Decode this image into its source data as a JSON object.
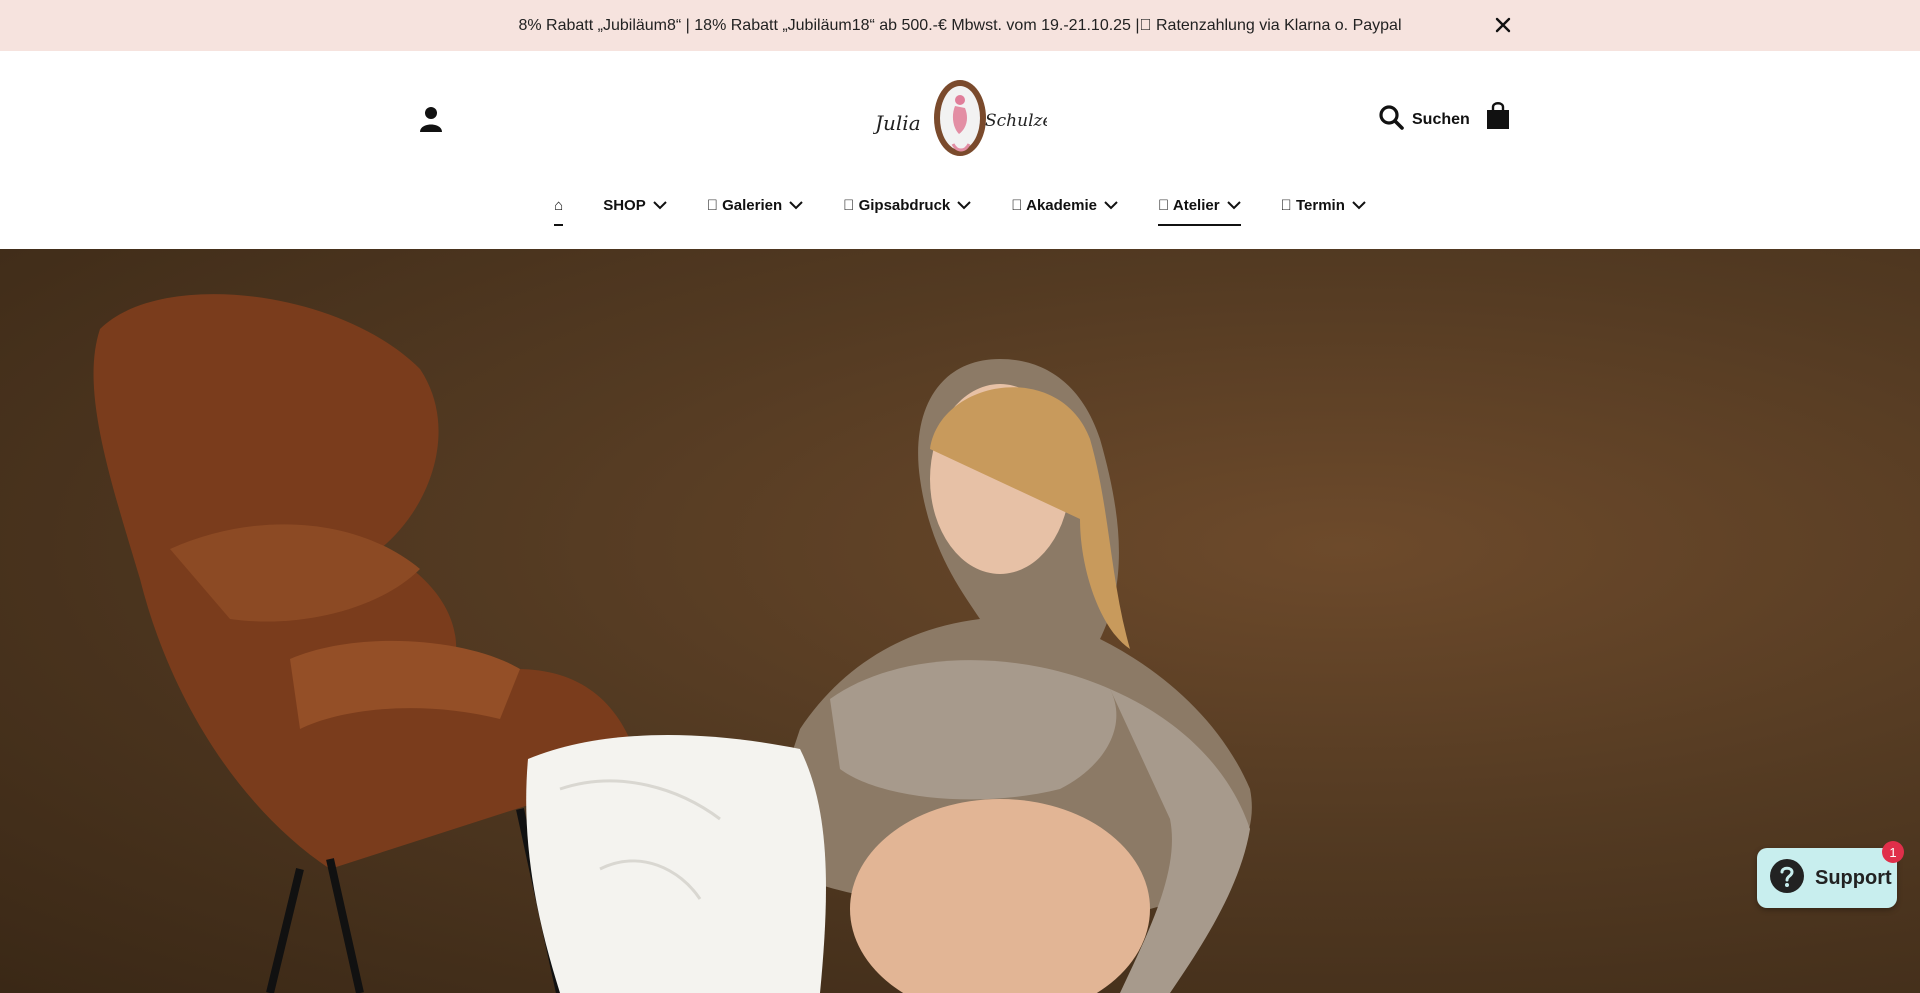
{
  "announcement": {
    "text": "8% Rabatt „Jubiläum8“ | 18% Rabatt „Jubiläum18“ ab 500.-€ Mbwst. vom 19.-21.10.25 |\u0000 Ratenzahlung via Klarna o. Paypal"
  },
  "header": {
    "logo_text_left": "Julia",
    "logo_text_right": "Schulze",
    "search_label": "Suchen"
  },
  "nav": {
    "home_icon": "⌂",
    "items": [
      {
        "label": "SHOP"
      },
      {
        "label": "\u0000 Galerien"
      },
      {
        "label": "\u0000 Gipsabdruck"
      },
      {
        "label": "\u0000 Akademie"
      },
      {
        "label": "\u0000 Atelier"
      },
      {
        "label": "\u0000 Termin"
      }
    ]
  },
  "support": {
    "label": "Support",
    "badge": "1"
  },
  "colors": {
    "announce_bg": "#f6e3de",
    "hero_bg": "#533a22",
    "support_bg": "#c8eeee",
    "badge_bg": "#e02f4a"
  }
}
